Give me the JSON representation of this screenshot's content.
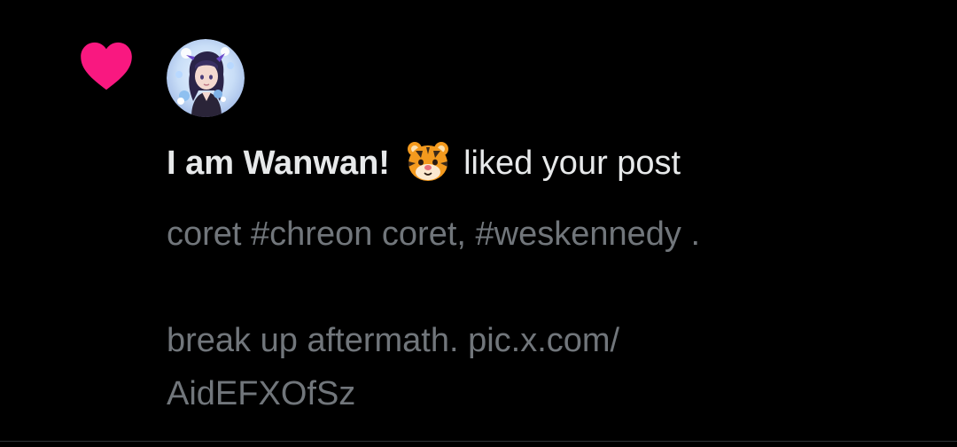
{
  "notification": {
    "type_icon": "heart-icon",
    "type_icon_color": "#f91880",
    "user_avatar": "anime-avatar",
    "user_name": "I am Wanwan!",
    "user_name_emoji": "tiger-face-emoji",
    "action_text": "liked your post",
    "post_lines": [
      "coret #chreon coret, #weskennedy .",
      "",
      "break up aftermath. pic.x.com/",
      "AidEFXOfSz"
    ]
  },
  "colors": {
    "background": "#000000",
    "primary_text": "#e7e9ea",
    "secondary_text": "#71767b",
    "like_pink": "#f91880",
    "divider": "#2f3336"
  }
}
